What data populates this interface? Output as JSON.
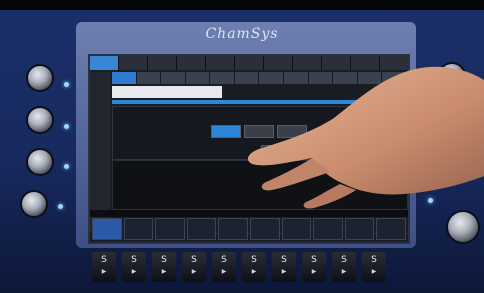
{
  "brand": "ChamSys",
  "screen": {
    "tabs": [
      "",
      "",
      "",
      "",
      "",
      "",
      "",
      "",
      "",
      "",
      ""
    ],
    "tools": [
      "",
      "",
      "",
      "",
      "",
      "",
      "",
      "",
      "",
      "",
      "",
      ""
    ],
    "panel_buttons": [
      "",
      "",
      ""
    ],
    "active_tab_index": 0,
    "active_tool_index": 0,
    "active_panel_button_index": 0
  },
  "faders": {
    "key_label": "S",
    "count": 10
  },
  "colors": {
    "accent": "#2e86d9",
    "console": "#1b2f6a",
    "led": "#9fd8ff"
  }
}
